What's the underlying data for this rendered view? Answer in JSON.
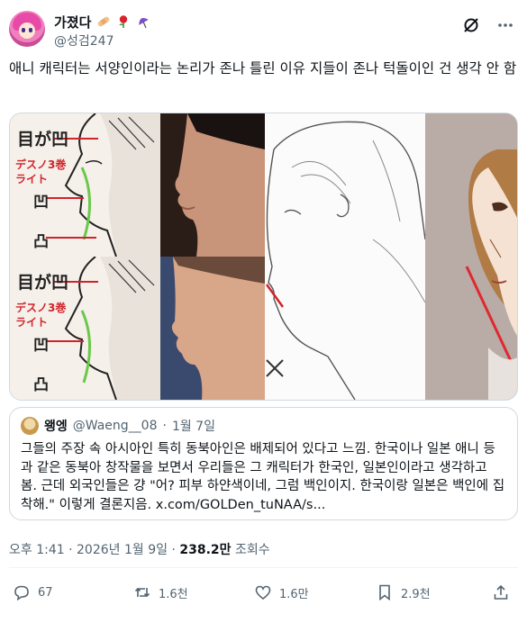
{
  "author": {
    "display_name": "가졌다",
    "handle": "@성검247",
    "emojis": [
      "bandage",
      "rose",
      "umbrella"
    ]
  },
  "tweet": {
    "text": "애니 캐릭터는 서양인이라는 논리가 존나 틀린 이유 지들이 존나 턱돌이인 건 생각 안 함"
  },
  "media": {
    "labels": {
      "a1": "目が凹",
      "a2": "デスノ3巻",
      "a3": "ライト",
      "a4": "凹",
      "a5": "凸",
      "b1": "目が凹",
      "b2": "デスノ3巻",
      "b3": "ライト",
      "b4": "凹",
      "b5": "凸"
    }
  },
  "quote": {
    "name": "왱엥",
    "handle": "@Waeng__08",
    "date": "1월 7일",
    "text": "그들의 주장 속 아시아인 특히 동북아인은 배제되어 있다고 느낌. 한국이나 일본 애니 등과 같은 동북아 창작물을 보면서 우리들은 그 캐릭터가 한국인, 일본인이라고 생각하고 봄. 근데 외국인들은 걍 \"어? 피부 하얀색이네, 그럼 백인이지. 한국이랑 일본은 백인에 집착해.\" 이렇게 결론지음. x.com/GOLDen_tuNAA/s..."
  },
  "timestamp": {
    "time": "오후 1:41 · 2026년 1월 9일 · ",
    "views": "238.2만",
    "views_label": " 조회수"
  },
  "actions": {
    "replies": "67",
    "retweets": "1.6천",
    "likes": "1.6만",
    "bookmarks": "2.9천"
  },
  "colors": {
    "text": "#0f1419",
    "muted": "#536471",
    "border": "#cfd9de",
    "red_line": "#d0242b"
  }
}
